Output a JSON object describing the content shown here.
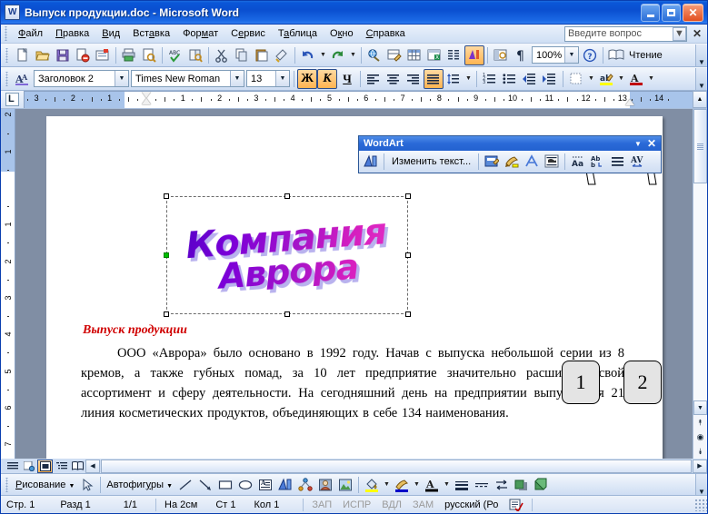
{
  "window": {
    "title": "Выпуск продукции.doc - Microsoft Word",
    "icon": "word-document-icon",
    "minimize_label": "Свернуть",
    "maximize_label": "Развернуть",
    "close_label": "Закрыть"
  },
  "menubar": {
    "items": [
      "Файл",
      "Правка",
      "Вид",
      "Вставка",
      "Формат",
      "Сервис",
      "Таблица",
      "Окно",
      "Справка"
    ],
    "ask_placeholder": "Введите вопрос",
    "close_doc_label": "✕"
  },
  "standard_toolbar": {
    "buttons": [
      "new-document-icon",
      "open-icon",
      "save-icon",
      "permission-icon",
      "email-icon",
      "print-icon",
      "print-preview-icon",
      "spelling-icon",
      "research-icon",
      "cut-icon",
      "copy-icon",
      "paste-icon",
      "format-painter-icon",
      "undo-icon",
      "redo-icon",
      "hyperlink-icon",
      "tables-and-borders-icon",
      "insert-table-icon",
      "insert-excel-sheet-icon",
      "columns-icon",
      "drawing-icon",
      "document-map-icon",
      "show-formatting-marks-icon"
    ],
    "zoom_value": "100%",
    "help_icon": "help-icon",
    "read_label": "Чтение",
    "read_icon": "reading-layout-icon"
  },
  "formatting_toolbar": {
    "styles_icon": "styles-and-formatting-icon",
    "style_value": "Заголовок 2",
    "font_value": "Times New Roman",
    "size_value": "13",
    "bold_label": "Ж",
    "italic_label": "К",
    "underline_label": "Ч",
    "buttons": [
      "align-left-icon",
      "align-center-icon",
      "align-right-icon",
      "align-justify-icon",
      "line-spacing-icon",
      "numbered-list-icon",
      "bulleted-list-icon",
      "decrease-indent-icon",
      "increase-indent-icon",
      "borders-icon",
      "highlight-icon",
      "font-color-icon"
    ]
  },
  "ruler": {
    "horizontal_labels": [
      "3",
      "2",
      "1",
      "1",
      "2",
      "3",
      "4",
      "5",
      "6",
      "7",
      "8",
      "9",
      "10",
      "11",
      "12",
      "13",
      "14"
    ],
    "vertical_labels": [
      "2",
      "1",
      "1",
      "2",
      "3",
      "4",
      "5",
      "6",
      "7"
    ]
  },
  "wordart_toolbar": {
    "title": "WordArt",
    "collapse_icon": "chevron-down-icon",
    "close_icon": "close-icon",
    "insert_label": "insert-wordart-icon",
    "edit_text_label": "Изменить текст...",
    "buttons": [
      "wordart-gallery-icon",
      "format-wordart-icon",
      "wordart-shape-icon",
      "text-wrapping-icon",
      "wordart-same-letter-heights-icon",
      "wordart-vertical-text-icon",
      "wordart-alignment-icon",
      "wordart-character-spacing-icon"
    ]
  },
  "callouts": [
    {
      "label": "1",
      "target": "wordart-same-letter-heights-icon"
    },
    {
      "label": "2",
      "target": "wordart-character-spacing-icon"
    }
  ],
  "document": {
    "wordart_line1": "Компания",
    "wordart_line2": "Аврора",
    "heading": "Выпуск продукции",
    "paragraph": "ООО «Аврора» было основано в 1992 году. Начав с выпуска небольшой серии из 8 кремов, а также губных помад, за 10 лет предприятие значительно расширило свой ассортимент и сферу деятельности. На сегодняшний день на предприятии выпускается 21 линия косметических продуктов, объединяющих в себе 134 наименования.",
    "wordart_gradient_start": "#5a00c8",
    "wordart_gradient_end": "#e22ec4",
    "wordart_shadow_color": "#b9b2ee",
    "heading_color": "#d00000"
  },
  "view_buttons": [
    "normal-view-icon",
    "web-layout-view-icon",
    "print-layout-view-icon",
    "outline-view-icon",
    "reading-view-icon"
  ],
  "drawing_toolbar": {
    "menu_label": "Рисование",
    "select_icon": "select-objects-icon",
    "autoshapes_label": "Автофигуры",
    "buttons": [
      "line-icon",
      "arrow-icon",
      "rectangle-icon",
      "oval-icon",
      "text-box-icon",
      "insert-wordart-icon",
      "insert-diagram-icon",
      "insert-clip-art-icon",
      "insert-picture-icon",
      "fill-color-icon",
      "line-color-icon",
      "font-color-icon",
      "line-style-icon",
      "dash-style-icon",
      "arrow-style-icon",
      "shadow-style-icon",
      "3d-style-icon"
    ]
  },
  "statusbar": {
    "page": "Стр. 1",
    "section": "Разд 1",
    "pages": "1/1",
    "at": "На 2см",
    "line": "Ст 1",
    "column": "Кол 1",
    "rec": "ЗАП",
    "trk": "ИСПР",
    "ext": "ВДЛ",
    "ovr": "ЗАМ",
    "language": "русский (Ро",
    "spell_icon": "spelling-status-icon"
  }
}
